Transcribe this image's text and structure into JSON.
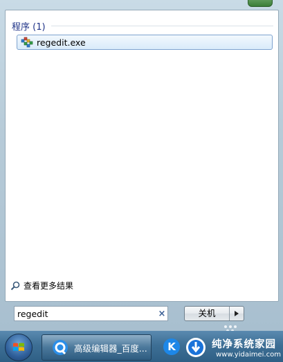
{
  "start_menu": {
    "group_title": "程序 (1)",
    "results": [
      {
        "label": "regedit.exe",
        "icon": "regedit-icon"
      }
    ],
    "see_more_label": "查看更多结果",
    "search": {
      "value": "regedit",
      "clear_symbol": "×"
    },
    "shutdown_label": "关机"
  },
  "taskbar": {
    "task_label": "高级编辑器_百度...",
    "k_label": "K"
  },
  "watermark": {
    "title": "纯净系统家园",
    "subtitle": "www.yidaimei.com"
  },
  "colors": {
    "group_title": "#1e3287",
    "selection_border": "#7da2ce",
    "taskbar": "#3e6f95"
  }
}
